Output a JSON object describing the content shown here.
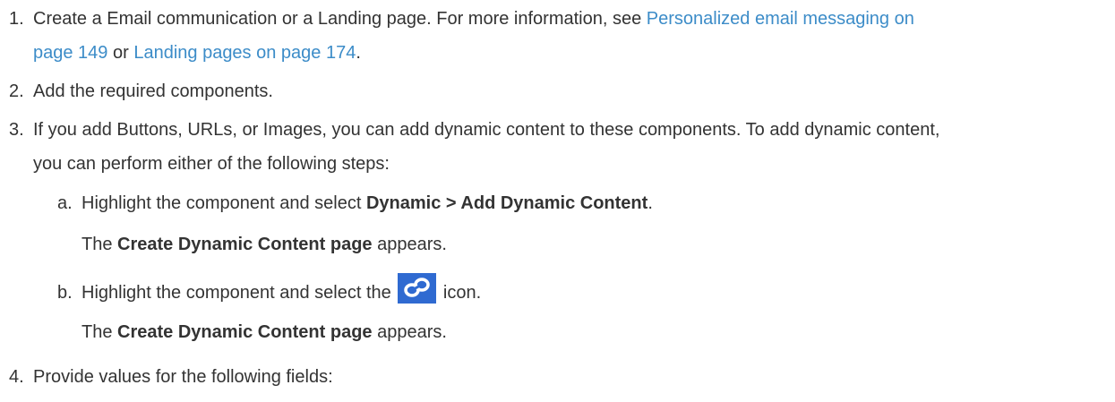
{
  "steps": {
    "s1": {
      "num": "1.",
      "text": "Create a Email communication or a Landing page. For more information, see ",
      "link1": "Personalized email messaging on",
      "link1_cont": "page 149",
      "or": " or ",
      "link2": "Landing pages on page 174",
      "end": "."
    },
    "s2": {
      "num": "2.",
      "text": "Add the required components."
    },
    "s3": {
      "num": "3.",
      "line1": "If you add Buttons, URLs, or Images, you can add dynamic content to these components. To add dynamic content,",
      "line2": "you can perform either of the following steps:",
      "a": {
        "num": "a.",
        "text": "Highlight the component and select ",
        "bold": "Dynamic > Add Dynamic Content",
        "end": ".",
        "note_pre": "The ",
        "note_bold": "Create Dynamic Content page",
        "note_post": " appears."
      },
      "b": {
        "num": "b.",
        "text": "Highlight the component and select the ",
        "icon": "dynamic-content-link-icon",
        "end": " icon.",
        "note_pre": "The ",
        "note_bold": "Create Dynamic Content page",
        "note_post": " appears."
      }
    },
    "s4": {
      "num": "4.",
      "text": "Provide values for the following fields:"
    }
  },
  "colors": {
    "text": "#333333",
    "link": "#3c8cc8",
    "icon_bg": "#2f6ad1"
  }
}
